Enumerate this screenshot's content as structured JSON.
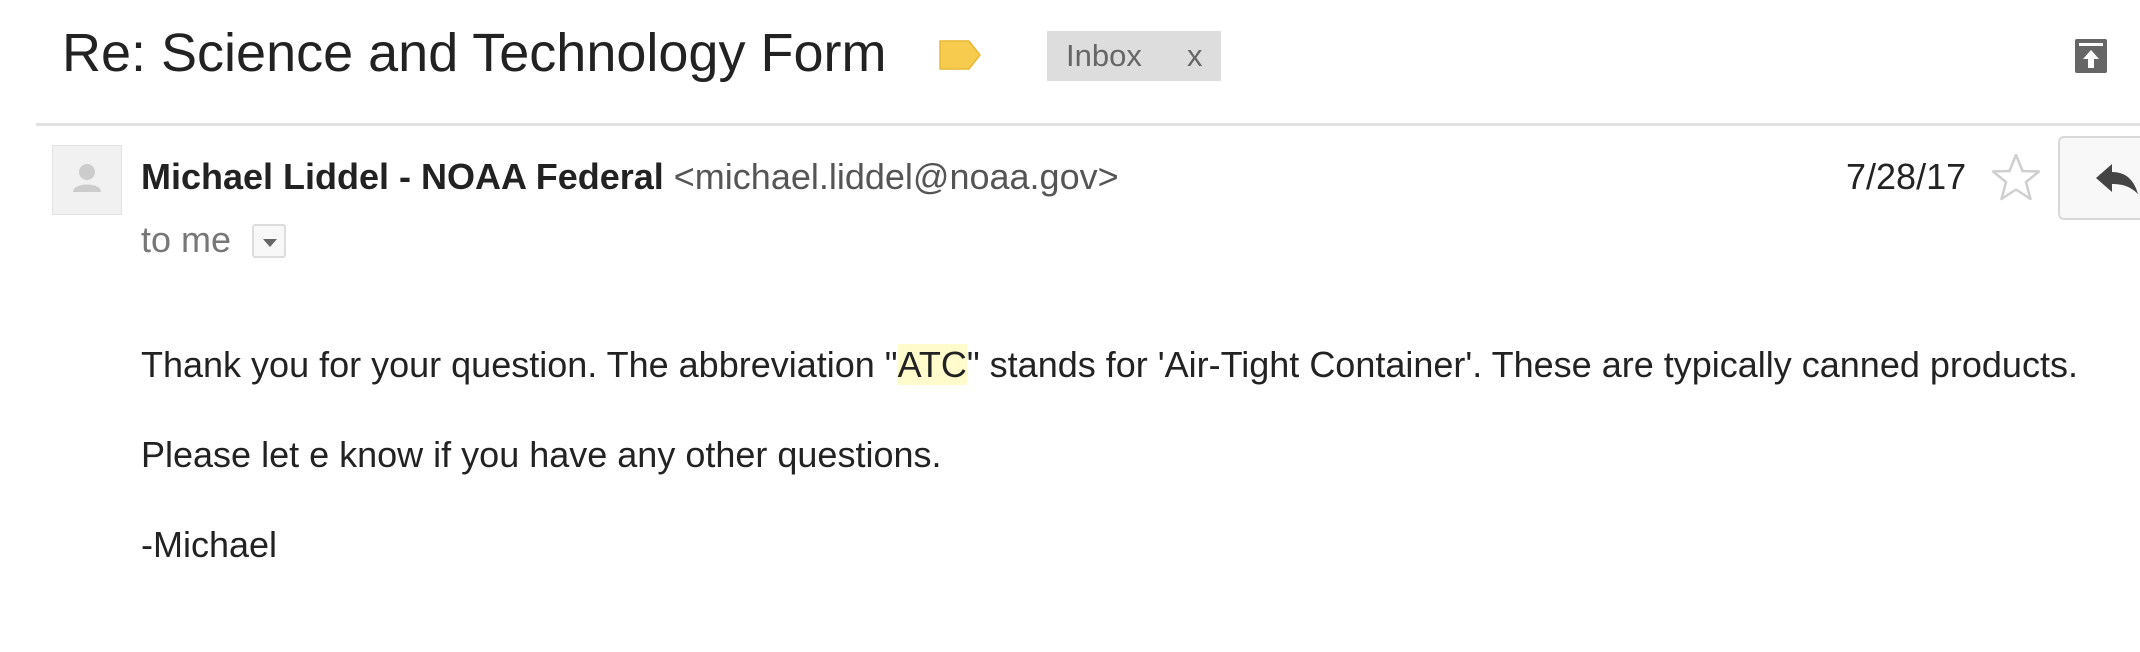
{
  "thread": {
    "subject": "Re: Science and Technology Form",
    "label_color": "#f7cb4d",
    "labels": [
      {
        "name": "Inbox",
        "remove_glyph": "x"
      }
    ]
  },
  "message": {
    "sender_name": "Michael Liddel - NOAA Federal",
    "sender_email": "<michael.liddel@noaa.gov>",
    "recipient": "to me",
    "date": "7/28/17",
    "body": {
      "p1_before": "Thank you for your question.  The abbreviation \"",
      "p1_highlight": "ATC",
      "p1_after": "\" stands for 'Air-Tight Container'.  These are typically canned products.",
      "p2": "Please let e know if you have any other questions.",
      "p3": "-Michael"
    }
  },
  "icons": {
    "archive": "archive-icon",
    "star": "star-outline-icon",
    "reply": "reply-arrow-icon",
    "avatar": "default-avatar-icon",
    "label": "label-tag-icon",
    "details": "chevron-down-icon"
  }
}
